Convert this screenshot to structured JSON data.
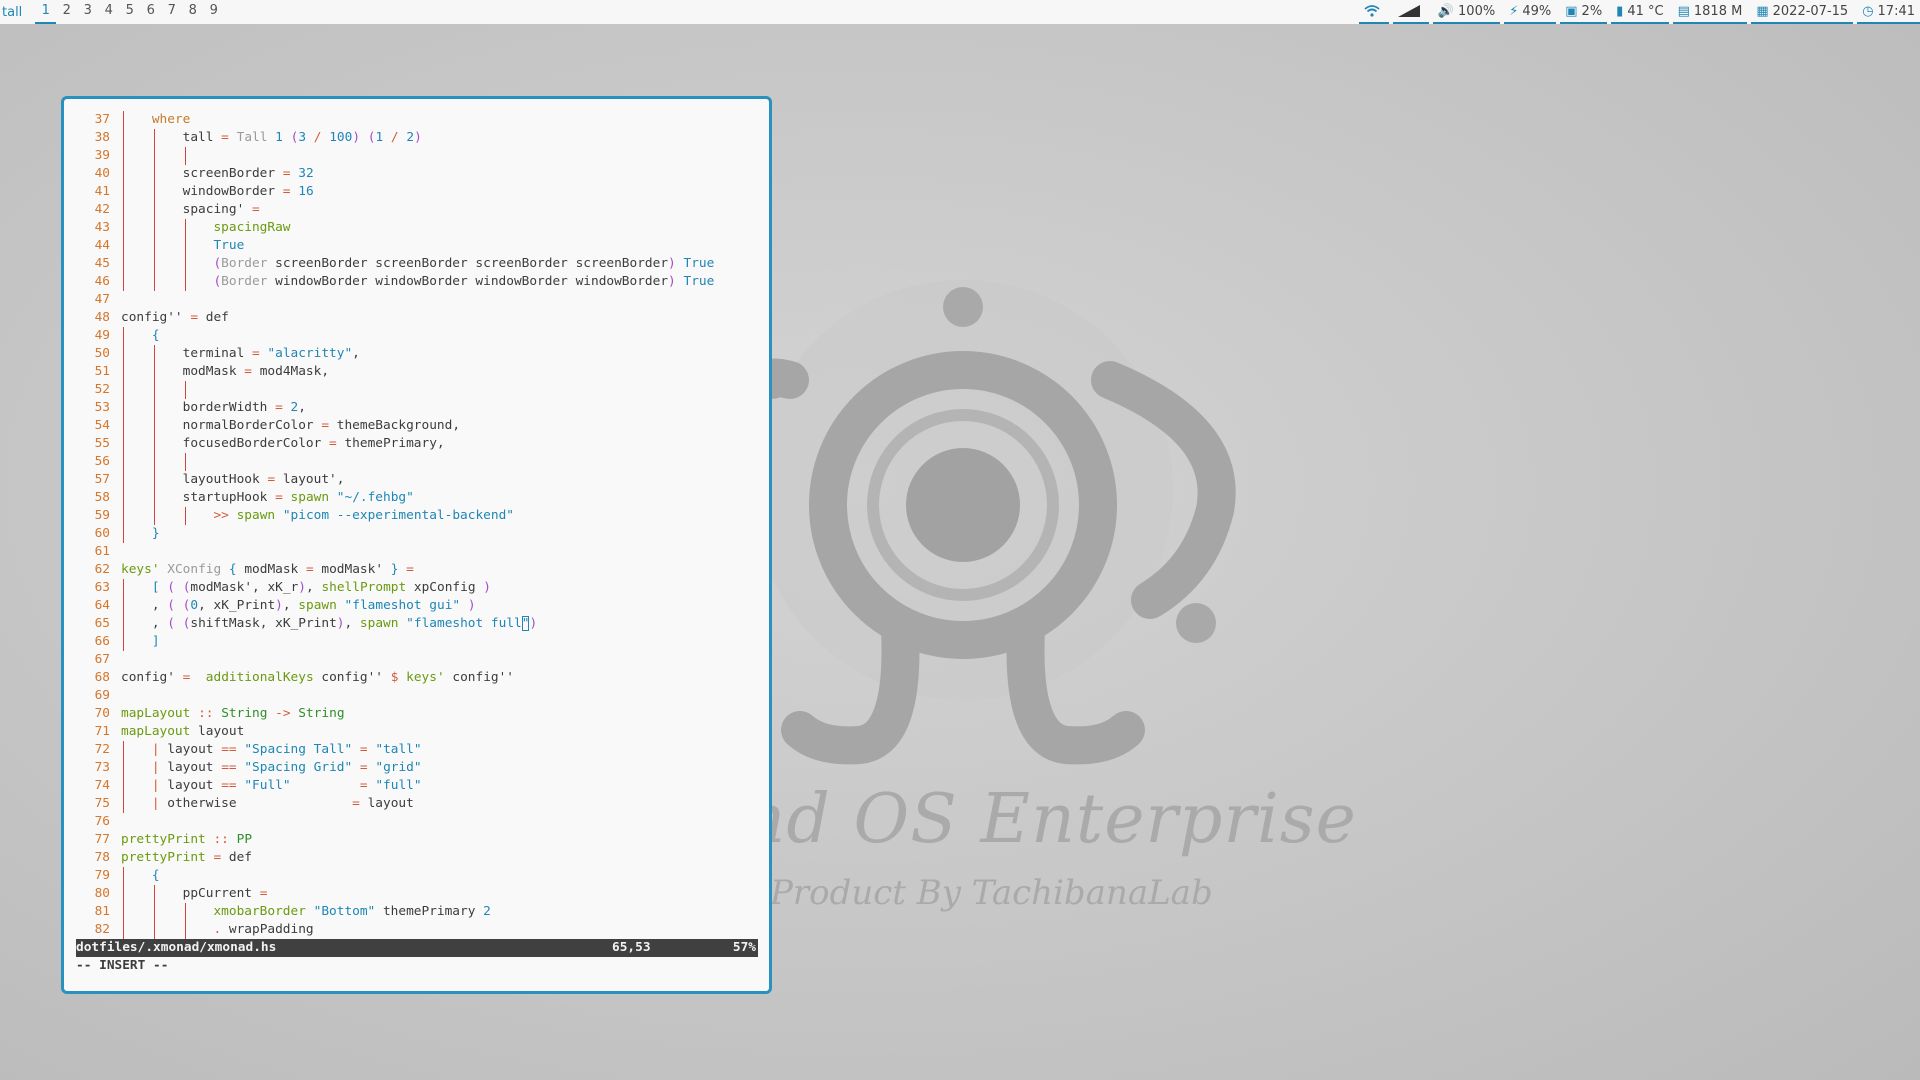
{
  "topbar": {
    "layout": "tall",
    "workspaces": [
      "1",
      "2",
      "3",
      "4",
      "5",
      "6",
      "7",
      "8",
      "9"
    ],
    "active_workspace": "1",
    "status": {
      "wifi_icon": "wifi-icon",
      "signal_icon": "signal-icon",
      "volume": "100%",
      "battery": "49%",
      "cpu": "2%",
      "temperature": "41 °C",
      "memory": "1818 M",
      "date": "2022-07-15",
      "time": "17:41"
    },
    "accent_color": "#1f86b5"
  },
  "wallpaper": {
    "title": "and OS Enterprise",
    "subtitle": "Product By TachibanaLab"
  },
  "editor": {
    "file": "dotfiles/.xmonad/xmonad.hs",
    "position": "65,53",
    "percent": "57%",
    "mode": "-- INSERT --",
    "lines": [
      {
        "n": "37",
        "g": 1,
        "html": "    <span class='kw'>where</span>"
      },
      {
        "n": "38",
        "g": 2,
        "html": "        tall <span class='op'>=</span> <span class='ty'>Tall</span> <span class='num'>1</span> <span class='par'>(</span><span class='num'>3</span> <span class='op'>/</span> <span class='num'>100</span><span class='par'>)</span> <span class='par'>(</span><span class='num'>1</span> <span class='op'>/</span> <span class='num'>2</span><span class='par'>)</span>"
      },
      {
        "n": "39",
        "g": 3,
        "html": ""
      },
      {
        "n": "40",
        "g": 2,
        "html": "        screenBorder <span class='op'>=</span> <span class='num'>32</span>"
      },
      {
        "n": "41",
        "g": 2,
        "html": "        windowBorder <span class='op'>=</span> <span class='num'>16</span>"
      },
      {
        "n": "42",
        "g": 2,
        "html": "        spacing' <span class='op'>=</span>"
      },
      {
        "n": "43",
        "g": 3,
        "html": "            <span class='fn2'>spacingRaw</span>"
      },
      {
        "n": "44",
        "g": 3,
        "html": "            <span class='str'>True</span>"
      },
      {
        "n": "45",
        "g": 3,
        "html": "            <span class='par'>(</span><span class='ty'>Border</span> screenBorder screenBorder screenBorder screenBorder<span class='par'>)</span> <span class='str'>True</span>"
      },
      {
        "n": "46",
        "g": 3,
        "html": "            <span class='par'>(</span><span class='ty'>Border</span> windowBorder windowBorder windowBorder windowBorder<span class='par'>)</span> <span class='str'>True</span>"
      },
      {
        "n": "47",
        "g": 0,
        "html": ""
      },
      {
        "n": "48",
        "g": 0,
        "html": "config'' <span class='op'>=</span> def"
      },
      {
        "n": "49",
        "g": 1,
        "html": "    <span class='brc'>{</span>"
      },
      {
        "n": "50",
        "g": 2,
        "html": "        terminal <span class='op'>=</span> <span class='str'>\"alacritty\"</span>,"
      },
      {
        "n": "51",
        "g": 2,
        "html": "        modMask <span class='op'>=</span> mod4Mask,"
      },
      {
        "n": "52",
        "g": 3,
        "html": ""
      },
      {
        "n": "53",
        "g": 2,
        "html": "        borderWidth <span class='op'>=</span> <span class='num'>2</span>,"
      },
      {
        "n": "54",
        "g": 2,
        "html": "        normalBorderColor <span class='op'>=</span> themeBackground,"
      },
      {
        "n": "55",
        "g": 2,
        "html": "        focusedBorderColor <span class='op'>=</span> themePrimary,"
      },
      {
        "n": "56",
        "g": 3,
        "html": ""
      },
      {
        "n": "57",
        "g": 2,
        "html": "        layoutHook <span class='op'>=</span> layout',"
      },
      {
        "n": "58",
        "g": 2,
        "html": "        startupHook <span class='op'>=</span> <span class='fn2'>spawn</span> <span class='str'>\"~/.fehbg\"</span>"
      },
      {
        "n": "59",
        "g": 3,
        "html": "            <span class='op'>&gt;&gt;</span> <span class='fn2'>spawn</span> <span class='str'>\"picom --experimental-backend\"</span>"
      },
      {
        "n": "60",
        "g": 1,
        "html": "    <span class='brc'>}</span>"
      },
      {
        "n": "61",
        "g": 0,
        "html": ""
      },
      {
        "n": "62",
        "g": 0,
        "html": "<span class='fn2'>keys'</span> <span class='ty'>XConfig</span> <span class='brc'>{</span> modMask <span class='op'>=</span> modMask' <span class='brc'>}</span> <span class='op'>=</span>"
      },
      {
        "n": "63",
        "g": 1,
        "html": "    <span class='brc'>[</span> <span class='par'>(</span> <span class='par'>(</span>modMask', xK_r<span class='par'>)</span>, <span class='fn2'>shellPrompt</span> xpConfig <span class='par'>)</span>"
      },
      {
        "n": "64",
        "g": 1,
        "html": "    , <span class='par'>(</span> <span class='par'>(</span><span class='num'>0</span>, xK_Print<span class='par'>)</span>, <span class='fn2'>spawn</span> <span class='str'>\"flameshot gui\"</span> <span class='par'>)</span>"
      },
      {
        "n": "65",
        "g": 1,
        "html": "    , <span class='par'>(</span> <span class='par'>(</span>shiftMask, xK_Print<span class='par'>)</span>, <span class='fn2'>spawn</span> <span class='str'>\"flameshot full<span class='cursor'>\"</span></span><span class='par'>)</span>"
      },
      {
        "n": "66",
        "g": 1,
        "html": "    <span class='brc'>]</span>"
      },
      {
        "n": "67",
        "g": 0,
        "html": ""
      },
      {
        "n": "68",
        "g": 0,
        "html": "config' <span class='op'>=</span>  <span class='fn2'>additionalKeys</span> config'' <span class='op'>$</span> <span class='fn2'>keys'</span> config''"
      },
      {
        "n": "69",
        "g": 0,
        "html": ""
      },
      {
        "n": "70",
        "g": 0,
        "html": "<span class='fn2'>mapLayout</span> <span class='op'>::</span> <span class='cons'>String</span> <span class='op'>-&gt;</span> <span class='cons'>String</span>"
      },
      {
        "n": "71",
        "g": 0,
        "html": "<span class='fn2'>mapLayout</span> layout"
      },
      {
        "n": "72",
        "g": 1,
        "html": "    <span class='op'>|</span> layout <span class='op'>==</span> <span class='str'>\"Spacing Tall\"</span> <span class='op'>=</span> <span class='str'>\"tall\"</span>"
      },
      {
        "n": "73",
        "g": 1,
        "html": "    <span class='op'>|</span> layout <span class='op'>==</span> <span class='str'>\"Spacing Grid\"</span> <span class='op'>=</span> <span class='str'>\"grid\"</span>"
      },
      {
        "n": "74",
        "g": 1,
        "html": "    <span class='op'>|</span> layout <span class='op'>==</span> <span class='str'>\"Full\"</span>         <span class='op'>=</span> <span class='str'>\"full\"</span>"
      },
      {
        "n": "75",
        "g": 1,
        "html": "    <span class='op'>|</span> otherwise               <span class='op'>=</span> layout"
      },
      {
        "n": "76",
        "g": 0,
        "html": ""
      },
      {
        "n": "77",
        "g": 0,
        "html": "<span class='fn2'>prettyPrint</span> <span class='op'>::</span> <span class='cons'>PP</span>"
      },
      {
        "n": "78",
        "g": 0,
        "html": "<span class='fn2'>prettyPrint</span> <span class='op'>=</span> def"
      },
      {
        "n": "79",
        "g": 1,
        "html": "    <span class='brc'>{</span>"
      },
      {
        "n": "80",
        "g": 2,
        "html": "        ppCurrent <span class='op'>=</span>"
      },
      {
        "n": "81",
        "g": 3,
        "html": "            <span class='fn2'>xmobarBorder</span> <span class='str'>\"Bottom\"</span> themePrimary <span class='num'>2</span>"
      },
      {
        "n": "82",
        "g": 3,
        "html": "            <span class='op'>.</span> wrapPadding"
      }
    ]
  }
}
